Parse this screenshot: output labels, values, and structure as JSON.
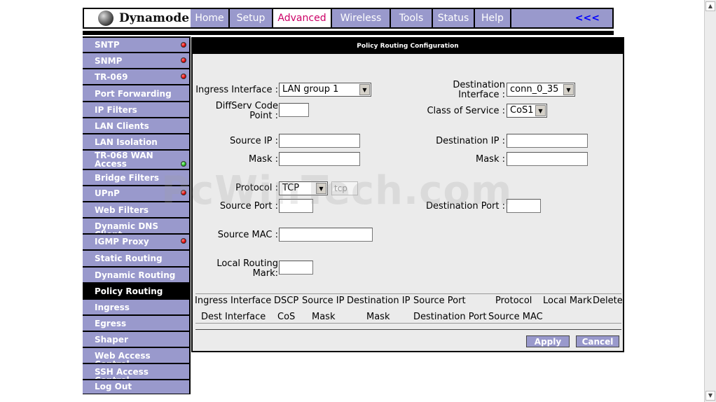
{
  "brand": {
    "logo_text": "Dynamode"
  },
  "nav": {
    "tabs": [
      {
        "label": "Home"
      },
      {
        "label": "Setup"
      },
      {
        "label": "Advanced",
        "active": true
      },
      {
        "label": "Wireless"
      },
      {
        "label": "Tools"
      },
      {
        "label": "Status"
      },
      {
        "label": "Help"
      }
    ],
    "back_label": "<<<"
  },
  "sidebar": {
    "items": [
      {
        "label": "SNTP",
        "status": "red"
      },
      {
        "label": "SNMP",
        "status": "red"
      },
      {
        "label": "TR-069",
        "status": "red"
      },
      {
        "label": "Port Forwarding"
      },
      {
        "label": "IP Filters"
      },
      {
        "label": "LAN Clients"
      },
      {
        "label": "LAN Isolation"
      },
      {
        "label": "TR-068 WAN Access",
        "status": "green"
      },
      {
        "label": "Bridge Filters"
      },
      {
        "label": "UPnP",
        "status": "red"
      },
      {
        "label": "Web Filters"
      },
      {
        "label": "Dynamic DNS Client"
      },
      {
        "label": "IGMP Proxy",
        "status": "red"
      },
      {
        "label": "Static Routing"
      },
      {
        "label": "Dynamic Routing"
      },
      {
        "label": "Policy Routing",
        "active": true
      },
      {
        "label": "Ingress"
      },
      {
        "label": "Egress"
      },
      {
        "label": "Shaper"
      },
      {
        "label": "Web Access Control"
      },
      {
        "label": "SSH Access Control"
      },
      {
        "label": "Log Out"
      }
    ]
  },
  "panel": {
    "title": "Policy Routing Configuration",
    "form": {
      "ingress_interface": {
        "label": "Ingress Interface :",
        "value": "LAN group 1"
      },
      "destination_interface": {
        "label": "Destination Interface :",
        "value": "conn_0_35"
      },
      "diffserv": {
        "label": "DiffServ Code Point :",
        "value": ""
      },
      "class_of_service": {
        "label": "Class of Service :",
        "value": "CoS1"
      },
      "source_ip": {
        "label": "Source IP :",
        "value": ""
      },
      "destination_ip": {
        "label": "Destination IP :",
        "value": ""
      },
      "source_mask": {
        "label": "Mask :",
        "value": ""
      },
      "dest_mask": {
        "label": "Mask :",
        "value": ""
      },
      "protocol": {
        "label": "Protocol :",
        "value": "TCP",
        "text_value": "tcp"
      },
      "source_port": {
        "label": "Source Port :",
        "value": ""
      },
      "destination_port": {
        "label": "Destination Port :",
        "value": ""
      },
      "source_mac": {
        "label": "Source MAC :",
        "value": ""
      },
      "local_routing_mark": {
        "label": "Local Routing Mark:",
        "value": ""
      }
    },
    "table": {
      "header_row1": [
        "Ingress Interface",
        "DSCP",
        "Source IP",
        "Destination IP",
        "Source Port",
        "Protocol",
        "Local Mark",
        "Delete"
      ],
      "header_row2": [
        "Dest Interface",
        "CoS",
        "Mask",
        "Mask",
        "Destination Port",
        "Source MAC"
      ]
    },
    "buttons": {
      "apply": "Apply",
      "cancel": "Cancel"
    }
  },
  "watermark": "PcWinTech.com"
}
